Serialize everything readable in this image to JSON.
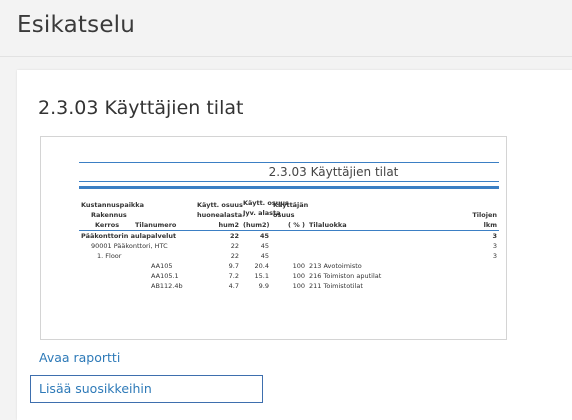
{
  "page": {
    "title": "Esikatselu"
  },
  "report": {
    "heading": "2.3.03 Käyttäjien tilat",
    "open_link": "Avaa raportti",
    "favorite_button": "Lisää suosikkeihin",
    "preview": {
      "title": "2.3.03 Käyttäjien tilat",
      "headers": {
        "row1": [
          "Kustannuspaikka",
          "Käytt. osuus",
          "Käytt. osuus",
          "Käyttäjän",
          "",
          ""
        ],
        "row2": [
          "Rakennus",
          "huonealasta",
          "Jyv. alasta",
          "osuus",
          "",
          "Tilojen"
        ],
        "row3": [
          "Kerros",
          "Tilanumero",
          "hum2",
          "(hum2)",
          "( % )",
          "Tilaluokka",
          "lkm"
        ]
      },
      "rows": [
        {
          "indent": 0,
          "name": "Pääkonttorin aulapalvelut",
          "osuus": "22",
          "jyv": "45",
          "pct": "",
          "luokka": "",
          "lkm": "3",
          "bold": true
        },
        {
          "indent": 1,
          "name": "90001 Pääkonttori, HTC",
          "osuus": "22",
          "jyv": "45",
          "pct": "",
          "luokka": "",
          "lkm": "3",
          "bold": false
        },
        {
          "indent": 2,
          "name": "1. Floor",
          "osuus": "22",
          "jyv": "45",
          "pct": "",
          "luokka": "",
          "lkm": "3",
          "bold": false
        },
        {
          "indent": 3,
          "name": "AA105",
          "osuus": "9.7",
          "jyv": "20.4",
          "pct": "100",
          "luokka": "213 Avotoimisto",
          "lkm": "",
          "bold": false
        },
        {
          "indent": 3,
          "name": "AA105.1",
          "osuus": "7.2",
          "jyv": "15.1",
          "pct": "100",
          "luokka": "216 Toimiston aputilat",
          "lkm": "",
          "bold": false
        },
        {
          "indent": 3,
          "name": "AB112.4b",
          "osuus": "4.7",
          "jyv": "9.9",
          "pct": "100",
          "luokka": "211 Toimistotilat",
          "lkm": "",
          "bold": false
        }
      ]
    }
  },
  "colors": {
    "accent": "#2e7ab8",
    "rule": "#3b7fc4",
    "button_border": "#3e6fae"
  }
}
